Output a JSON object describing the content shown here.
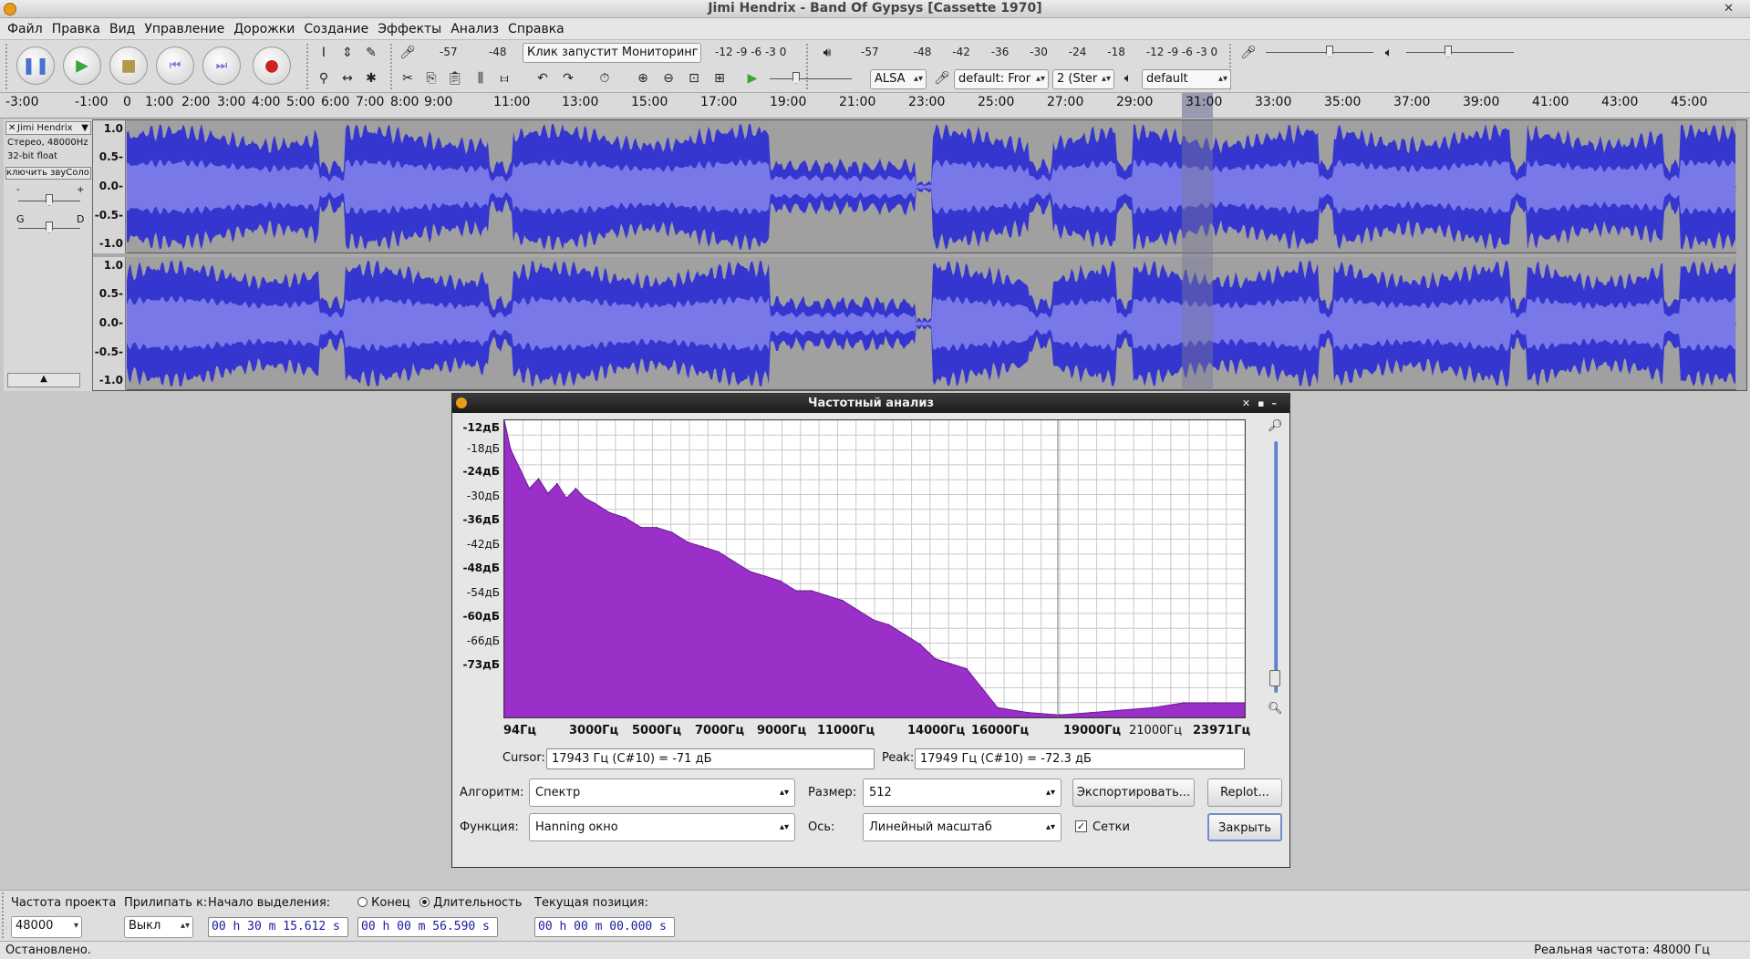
{
  "window": {
    "title": "Jimi Hendrix - Band Of Gypsys [Cassette 1970]"
  },
  "menu": [
    "Файл",
    "Правка",
    "Вид",
    "Управление",
    "Дорожки",
    "Создание",
    "Эффекты",
    "Анализ",
    "Справка"
  ],
  "toolbar": {
    "record_meter_hint": "Клик запустит Мониторинг",
    "record_meter_left": [
      "-57",
      "-48"
    ],
    "record_meter_right": "-12 -9 -6 -3 0",
    "play_meter_scale": [
      "-57",
      "-48",
      "-42",
      "-36",
      "-30",
      "-24",
      "-18",
      "-12 -9 -6 -3 0"
    ],
    "host": "ALSA",
    "rec_device": "default: Fror",
    "channels": "2 (Ster",
    "play_device": "default"
  },
  "ruler": {
    "ticks": [
      "-3:00",
      "-1:00",
      "0",
      "1:00",
      "2:00",
      "3:00",
      "4:00",
      "5:00",
      "6:00",
      "7:00",
      "8:00",
      "9:00",
      "11:00",
      "13:00",
      "15:00",
      "17:00",
      "19:00",
      "21:00",
      "23:00",
      "25:00",
      "27:00",
      "29:00",
      "31:00",
      "33:00",
      "35:00",
      "37:00",
      "39:00",
      "41:00",
      "43:00",
      "45:00"
    ]
  },
  "track": {
    "name": "Jimi Hendrix",
    "format_line1": "Стерео, 48000Hz",
    "format_line2": "32-bit float",
    "mute_solo": "ключить звуСоло",
    "gain_minus": "-",
    "gain_plus": "+",
    "pan_left": "G",
    "pan_right": "D",
    "scale": [
      "1.0",
      "0.5-",
      "0.0-",
      "-0.5-",
      "-1.0"
    ],
    "colors": {
      "wave": "#3535d0",
      "rms": "#7878e8",
      "background": "#a0a0a0"
    }
  },
  "dialog": {
    "title": "Частотный анализ",
    "y_labels": [
      "-12дБ",
      "-18дБ",
      "-24дБ",
      "-30дБ",
      "-36дБ",
      "-42дБ",
      "-48дБ",
      "-54дБ",
      "-60дБ",
      "-66дБ",
      "-73дБ"
    ],
    "x_labels": [
      "94Гц",
      "3000Гц",
      "5000Гц",
      "7000Гц",
      "9000Гц",
      "11000Гц",
      "14000Гц",
      "16000Гц",
      "19000Гц",
      "21000Гц",
      "23971Гц"
    ],
    "cursor_label": "Cursor:",
    "cursor_value": "17943 Гц (C#10) = -71 дБ",
    "peak_label": "Peak:",
    "peak_value": "17949 Гц (C#10) = -72.3 дБ",
    "algorithm_label": "Алгоритм:",
    "algorithm_value": "Спектр",
    "size_label": "Размер:",
    "size_value": "512",
    "export_button": "Экспортировать...",
    "replot_button": "Replot...",
    "function_label": "Функция:",
    "function_value": "Hanning окно",
    "axis_label": "Ось:",
    "axis_value": "Линейный масштаб",
    "grids_label": "Сетки",
    "grids_checked": true,
    "close_button": "Закрыть",
    "spectrum_color": "#9b30c8"
  },
  "chart_data": {
    "type": "area",
    "title": "",
    "xlabel": "",
    "ylabel": "",
    "x_unit": "Гц",
    "y_unit": "дБ",
    "xlim": [
      94,
      23971
    ],
    "ylim": [
      -73,
      -12
    ],
    "grid": true,
    "x": [
      94,
      300,
      600,
      900,
      1200,
      1500,
      1800,
      2100,
      2400,
      2700,
      3000,
      3500,
      4000,
      4500,
      5000,
      5500,
      6000,
      6500,
      7000,
      7500,
      8000,
      8500,
      9000,
      9500,
      10000,
      10500,
      11000,
      11500,
      12000,
      12500,
      13000,
      13500,
      14000,
      14500,
      15000,
      15500,
      16000,
      17000,
      18000,
      19000,
      20000,
      21000,
      22000,
      23000,
      23971
    ],
    "y": [
      -12,
      -18,
      -22,
      -26,
      -24,
      -27,
      -25,
      -28,
      -26,
      -28,
      -29,
      -31,
      -32,
      -34,
      -34,
      -35,
      -37,
      -38,
      -39,
      -41,
      -43,
      -44,
      -45,
      -47,
      -47,
      -48,
      -49,
      -51,
      -53,
      -54,
      -56,
      -58,
      -61,
      -62,
      -63,
      -67,
      -71,
      -72,
      -72.5,
      -72,
      -71.5,
      -71,
      -70,
      -70,
      -70
    ]
  },
  "selection_bar": {
    "rate_label": "Частота проекта",
    "rate_value": "48000",
    "snap_label": "Прилипать к:",
    "snap_value": "Выкл",
    "sel_start_label": "Начало выделения:",
    "end_label": "Конец",
    "length_label": "Длительность",
    "length_selected": true,
    "sel_start": "00 h 30 m 15.612 s",
    "sel_length": "00 h 00 m 56.590 s",
    "pos_label": "Текущая позиция:",
    "pos_value": "00 h 00 m 00.000 s"
  },
  "status": {
    "left": "Остановлено.",
    "right": "Реальная частота: 48000 Гц"
  }
}
